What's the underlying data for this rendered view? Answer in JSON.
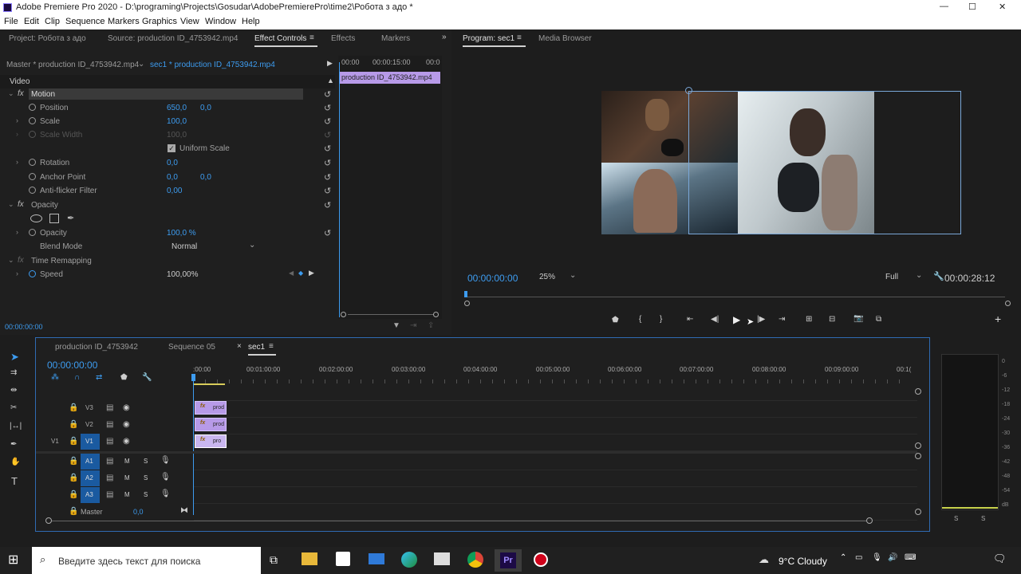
{
  "window": {
    "title": "Adobe Premiere Pro 2020 - D:\\programing\\Projects\\Gosudar\\AdobePremierePro\\time2\\Робота з адо *",
    "minimize": "—",
    "maximize": "☐",
    "close": "✕"
  },
  "menu": [
    "File",
    "Edit",
    "Clip",
    "Sequence",
    "Markers",
    "Graphics",
    "View",
    "Window",
    "Help"
  ],
  "left_panel": {
    "tabs": [
      "Project: Робота з адо",
      "Source: production ID_4753942.mp4",
      "Effect Controls",
      "Effects",
      "Markers"
    ],
    "active_tab": "Effect Controls",
    "master_label": "Master * production ID_4753942.mp4",
    "seq_label": "sec1 * production ID_4753942.mp4",
    "ruler": [
      "00:00",
      "00:00:15:00",
      "00:0"
    ],
    "clip_label": "production ID_4753942.mp4",
    "video_header": "Video",
    "motion": "Motion",
    "position": {
      "label": "Position",
      "x": "650,0",
      "y": "0,0"
    },
    "scale": {
      "label": "Scale",
      "value": "100,0"
    },
    "scale_width": {
      "label": "Scale Width",
      "value": "100,0"
    },
    "uniform_scale": "Uniform Scale",
    "rotation": {
      "label": "Rotation",
      "value": "0,0"
    },
    "anchor": {
      "label": "Anchor Point",
      "x": "0,0",
      "y": "0,0"
    },
    "antiflicker": {
      "label": "Anti-flicker Filter",
      "value": "0,00"
    },
    "opacity_group": "Opacity",
    "opacity": {
      "label": "Opacity",
      "value": "100,0 %"
    },
    "blend": {
      "label": "Blend Mode",
      "value": "Normal"
    },
    "time_remap": "Time Remapping",
    "speed": {
      "label": "Speed",
      "value": "100,00%"
    },
    "timecode": "00:00:00:00"
  },
  "program": {
    "tab": "Program: sec1",
    "tab2": "Media Browser",
    "timecode": "00:00:00:00",
    "zoom": "25%",
    "quality": "Full",
    "duration": "00:00:28:12"
  },
  "timeline": {
    "tabs": [
      "production ID_4753942",
      "Sequence 05",
      "sec1"
    ],
    "timecode": "00:00:00:00",
    "ruler": [
      ":00:00",
      "00:01:00:00",
      "00:02:00:00",
      "00:03:00:00",
      "00:04:00:00",
      "00:05:00:00",
      "00:06:00:00",
      "00:07:00:00",
      "00:08:00:00",
      "00:09:00:00",
      "00:1("
    ],
    "video_tracks": [
      "V3",
      "V2",
      "V1"
    ],
    "audio_tracks": [
      "A1",
      "A2",
      "A3"
    ],
    "source_v": "V1",
    "master_label": "Master",
    "master_value": "0,0",
    "clips": [
      "prod",
      "prod",
      "pro"
    ],
    "m_label": "M",
    "s_label": "S",
    "fx_label": "fx"
  },
  "meter": {
    "scale": [
      "0",
      "-6",
      "-12",
      "-18",
      "-24",
      "-30",
      "-36",
      "-42",
      "-48",
      "-54",
      "dB"
    ],
    "s1": "S",
    "s2": "S"
  },
  "taskbar": {
    "search_placeholder": "Введите здесь текст для поиска",
    "weather": "9°C  Cloudy"
  },
  "colors": {
    "accent": "#3d9cf0",
    "clip": "#b79ae8",
    "panel": "#232323"
  }
}
